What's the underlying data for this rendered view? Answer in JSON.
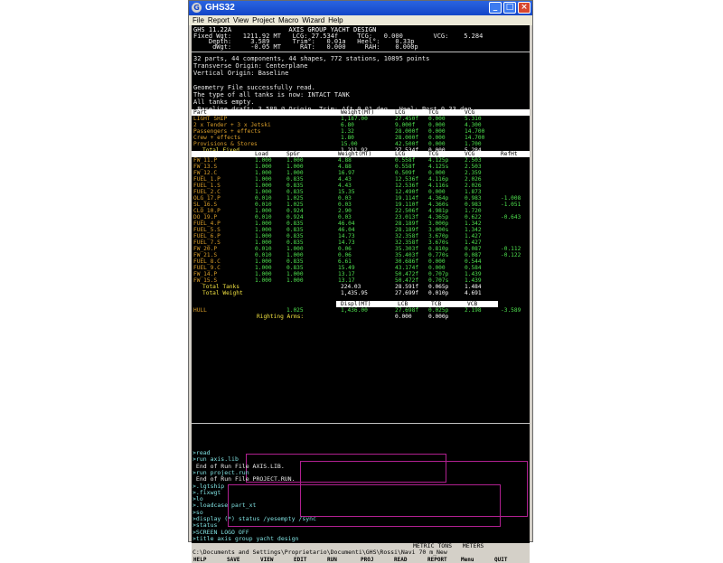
{
  "window": {
    "title": "GHS32"
  },
  "menu": [
    "File",
    "Report",
    "View",
    "Project",
    "Macro",
    "Wizard",
    "Help"
  ],
  "header": {
    "line1": "GHS 11.22A               AXIS GROUP YACHT DESIGN",
    "line2": "Fixed Wgt:   1211.92 MT   LCG: 27.534f     TCG:   0.000        VCG:    5.284",
    "line3": "    Depth:     3.589      Trim°:   0.01a   Heel°:    0.33p",
    "line4": "     dWgt:     -0.05 MT     RAT:   0.000     RAH:    0.000p"
  },
  "messages": [
    "32 parts, 44 components, 44 shapes, 772 stations, 10895 points",
    "Transverse Origin: Centerplane",
    "Vertical Origin: Baseline",
    "",
    "Geometry File successfully read.",
    "The type of all tanks is now: INTACT TANK",
    "All tanks empty.",
    " Baseline draft: 3.589 @ Origin, Trim: Aft 0.01 deg., Heel: Port 0.33 deg."
  ],
  "fixed_table": {
    "headers": [
      "Part",
      "Weight(MT)",
      "LCG",
      "TCG",
      "VCG"
    ],
    "rows": [
      [
        "LIGHT SHIP",
        "1,187.00",
        "27.450f",
        "0.000",
        "5.310"
      ],
      [
        "2 x Tender + 3 x Jetski",
        "6.80",
        "9.000f",
        "0.000",
        "4.300"
      ],
      [
        "Passengers + effects",
        "1.32",
        "28.000f",
        "0.000",
        "14.700"
      ],
      [
        "Crew + effects",
        "1.80",
        "28.000f",
        "0.000",
        "14.700"
      ],
      [
        "Provisions & Stores",
        "15.00",
        "42.500f",
        "0.000",
        "1.700"
      ]
    ],
    "total": [
      "Total Fixed",
      "1,211.92",
      "27.534f",
      "0.000",
      "5.284"
    ]
  },
  "tank_table": {
    "headers": [
      "Load",
      "SpGr",
      "Weight(MT)",
      "LCG",
      "TCG",
      "VCG",
      "RefHt"
    ],
    "rows": [
      [
        "FW_11.P",
        "1.000",
        "1.000",
        "4.88",
        "0.558f",
        "4.125p",
        "2.503",
        ""
      ],
      [
        "FW_13.S",
        "1.000",
        "1.000",
        "4.88",
        "0.558f",
        "4.125s",
        "2.503",
        ""
      ],
      [
        "FW_12.C",
        "1.000",
        "1.000",
        "16.97",
        "0.509f",
        "0.000",
        "2.359",
        ""
      ],
      [
        "FUEL_1.P",
        "1.000",
        "0.835",
        "4.43",
        "12.536f",
        "4.116p",
        "2.026",
        ""
      ],
      [
        "FUEL_1.S",
        "1.000",
        "0.835",
        "4.43",
        "12.536f",
        "4.116s",
        "2.026",
        ""
      ],
      [
        "FUEL_2.C",
        "1.000",
        "0.835",
        "15.35",
        "12.490f",
        "0.000",
        "1.873",
        ""
      ],
      [
        "OLG_17.P",
        "0.010",
        "1.025",
        "0.03",
        "19.114f",
        "4.364p",
        "0.983",
        "-1.008"
      ],
      [
        "SL_16.S",
        "0.010",
        "1.025",
        "0.03",
        "19.110f",
        "4.360s",
        "0.983",
        "-1.051"
      ],
      [
        "CLO_10.P",
        "1.000",
        "0.924",
        "2.90",
        "22.506f",
        "4.981p",
        "1.720",
        ""
      ],
      [
        "DO_19.P",
        "0.010",
        "0.924",
        "0.03",
        "23.013f",
        "4.365p",
        "0.622",
        "-0.643"
      ],
      [
        "FUEL_4.P",
        "1.000",
        "0.835",
        "46.04",
        "28.189f",
        "3.000p",
        "1.342",
        ""
      ],
      [
        "FUEL_5.S",
        "1.000",
        "0.835",
        "46.04",
        "28.189f",
        "3.000s",
        "1.342",
        ""
      ],
      [
        "FUEL_6.P",
        "1.000",
        "0.835",
        "14.73",
        "32.358f",
        "3.670p",
        "1.427",
        ""
      ],
      [
        "FUEL_7.S",
        "1.000",
        "0.835",
        "14.73",
        "32.358f",
        "3.670s",
        "1.427",
        ""
      ],
      [
        "FW_20.P",
        "0.010",
        "1.000",
        "0.06",
        "35.303f",
        "0.810p",
        "0.087",
        "-0.112"
      ],
      [
        "FW_21.S",
        "0.010",
        "1.000",
        "0.06",
        "35.403f",
        "0.770s",
        "0.087",
        "-0.122"
      ],
      [
        "FUEL_8.C",
        "1.000",
        "0.835",
        "6.61",
        "30.686f",
        "0.000",
        "0.544",
        ""
      ],
      [
        "FUEL_9.C",
        "1.000",
        "0.835",
        "15.49",
        "43.174f",
        "0.000",
        "0.584",
        ""
      ],
      [
        "FW_14.P",
        "1.000",
        "1.000",
        "13.17",
        "50.472f",
        "0.707p",
        "1.439",
        ""
      ],
      [
        "FW_15.S",
        "1.000",
        "1.000",
        "13.17",
        "50.472f",
        "0.707s",
        "1.439",
        ""
      ]
    ],
    "total_tanks": [
      "Total Tanks",
      "224.03",
      "28.591f",
      "0.065p",
      "1.484"
    ],
    "total_weight": [
      "Total Weight",
      "1,435.95",
      "27.699f",
      "0.010p",
      "4.691"
    ]
  },
  "displ_table": {
    "headers": [
      "Displ(MT)",
      "LCB",
      "TCB",
      "VCB"
    ],
    "hull": [
      "HULL",
      "1.025",
      "1,436.00",
      "27.698f",
      "0.025p",
      "2.198",
      "-3.589"
    ],
    "righting": [
      "Righting Arms:",
      "0.000",
      "0.000p"
    ]
  },
  "command_lines": [
    ">read",
    ">run axis.lib",
    " End of Run File AXIS.LIB.",
    ">run project.run",
    " End of Run File PROJECT.RUN.",
    ">.lgtship",
    ">.fixwgt",
    ">lo",
    ">.loadcase part_xt",
    ">so",
    ">display (*) status /yesempty /sync",
    ">status",
    ">SCREEN LOGO OFF",
    ">title axis group yacht design"
  ],
  "status": {
    "units": "METRIC TONS   METERS",
    "path": "C:\\Documents and Settings\\Proprietario\\Documenti\\GHS\\Rossi\\Navi 70 m_New"
  },
  "fkeys": [
    "HELP",
    "SAVE",
    "VIEW",
    "EDIT",
    "RUN",
    "PROJ",
    "READ",
    "REPORT",
    "Menu",
    "QUIT"
  ]
}
